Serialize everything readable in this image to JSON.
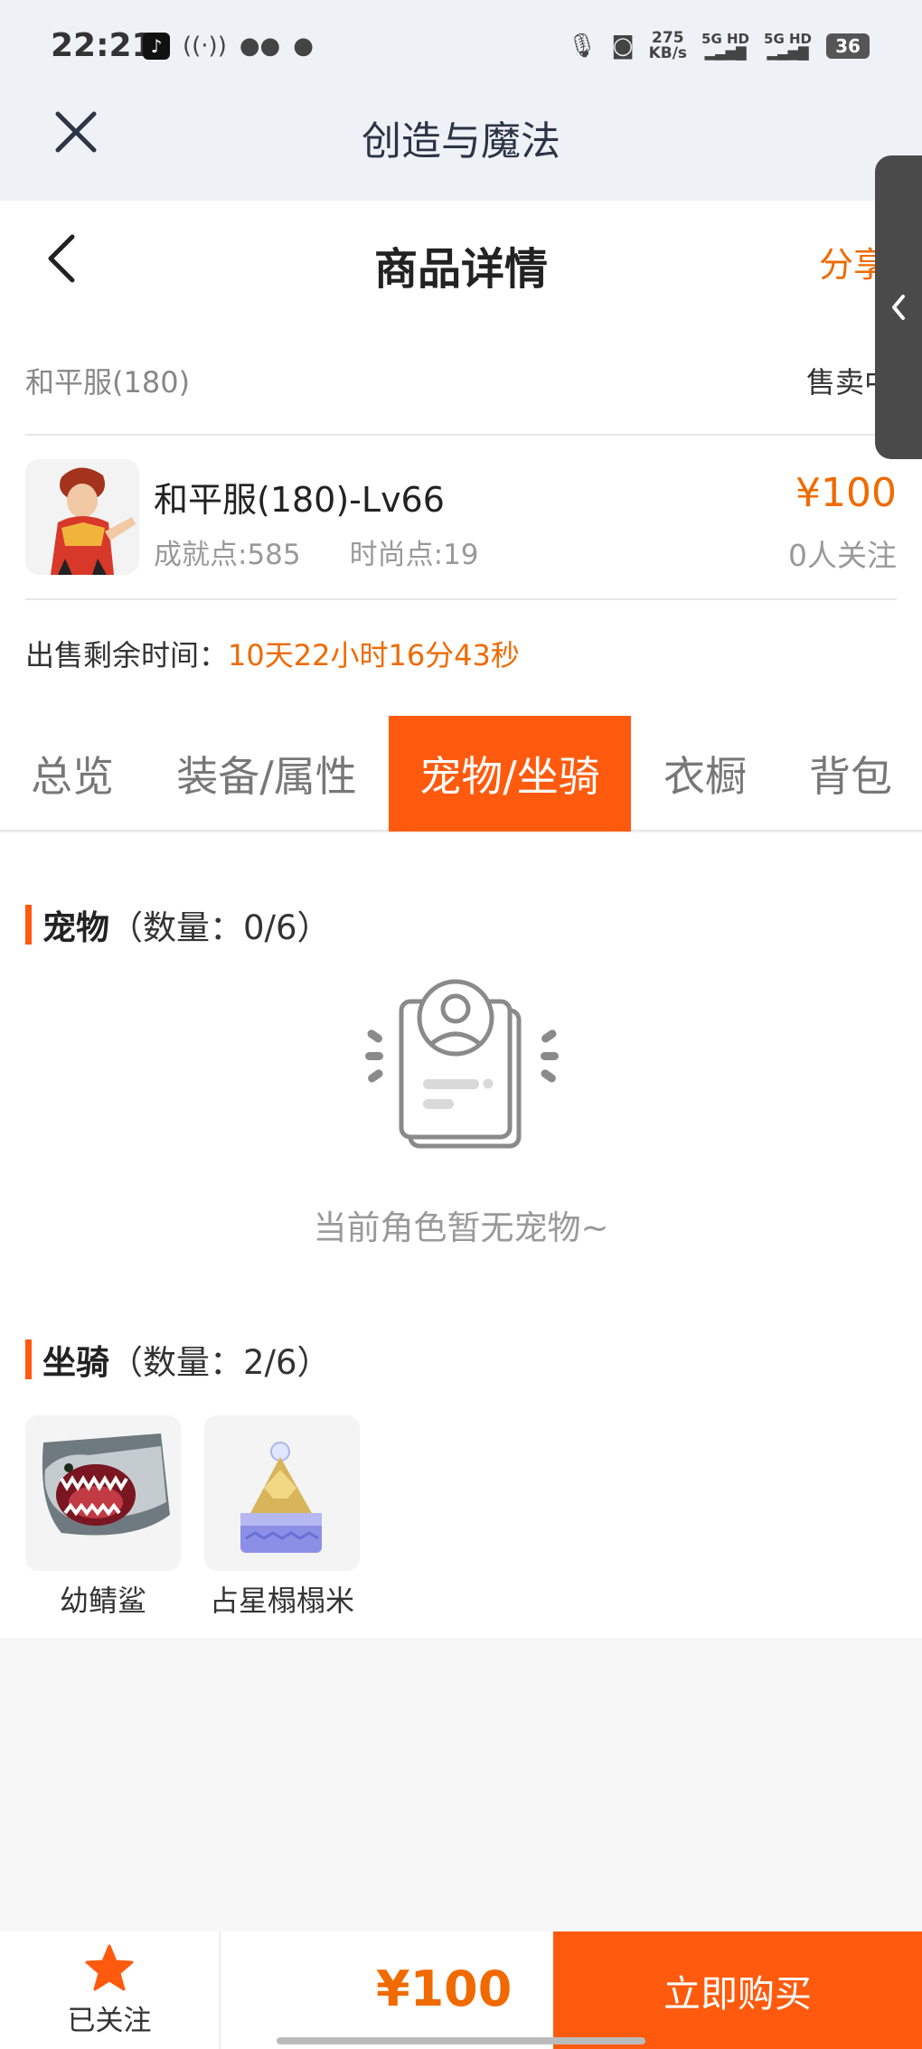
{
  "status_bar": {
    "time": "22:21",
    "net_speed_value": "275",
    "net_speed_unit": "KB/s",
    "sim1": "5G HD",
    "sim2": "5G HD",
    "battery": "36"
  },
  "app": {
    "title": "创造与魔法"
  },
  "page": {
    "title": "商品详情",
    "share_label": "分享"
  },
  "listing": {
    "server_name": "和平服(180)",
    "sale_status": "售卖中",
    "role_name": "和平服(180)-Lv66",
    "achievement": "成就点:585",
    "fashion": "时尚点:19",
    "price": "¥100",
    "followers": "0人关注",
    "remain_label": "出售剩余时间：",
    "remain_value": "10天22小时16分43秒"
  },
  "tabs": [
    {
      "label": "总览",
      "active": false
    },
    {
      "label": "装备/属性",
      "active": false
    },
    {
      "label": "宠物/坐骑",
      "active": true
    },
    {
      "label": "衣橱",
      "active": false
    },
    {
      "label": "背包",
      "active": false
    }
  ],
  "pets": {
    "title": "宠物",
    "count": "（数量：0/6）",
    "empty_text": "当前角色暂无宠物~"
  },
  "mounts": {
    "title": "坐骑",
    "count": "（数量：2/6）",
    "items": [
      {
        "name": "幼鲭鲨"
      },
      {
        "name": "占星榻榻米"
      }
    ]
  },
  "bottom_bar": {
    "follow_label": "已关注",
    "price": "¥100",
    "buy_label": "立即购买"
  },
  "colors": {
    "accent": "#ff5a0d",
    "price": "#f06a00"
  }
}
